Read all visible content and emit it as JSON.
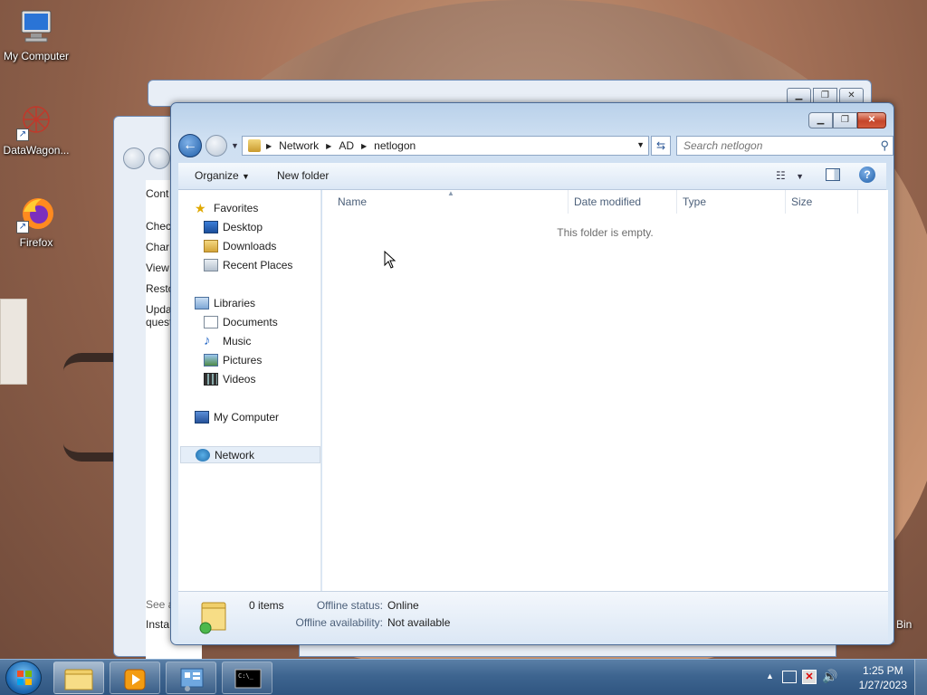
{
  "desktop": {
    "icons": [
      {
        "label": "My Computer"
      },
      {
        "label": "DataWagon..."
      },
      {
        "label": "Firefox"
      }
    ],
    "recycle_bin_partial": "Bin"
  },
  "back_window": {
    "links": [
      "Cont",
      "Chec",
      "Char",
      "View",
      "Resto",
      "Upda",
      "quest"
    ],
    "footer": [
      "See a",
      "Insta"
    ]
  },
  "explorer": {
    "caption_buttons": {
      "minimize": "▁",
      "maximize": "❐",
      "close": "✕"
    },
    "address": {
      "crumbs": [
        "Network",
        "AD",
        "netlogon"
      ]
    },
    "search": {
      "placeholder": "Search netlogon"
    },
    "toolbar": {
      "organize": "Organize",
      "new_folder": "New folder"
    },
    "nav": {
      "favorites": "Favorites",
      "desktop": "Desktop",
      "downloads": "Downloads",
      "recent_places": "Recent Places",
      "libraries": "Libraries",
      "documents": "Documents",
      "music": "Music",
      "pictures": "Pictures",
      "videos": "Videos",
      "my_computer": "My Computer",
      "network": "Network"
    },
    "columns": {
      "name": "Name",
      "date_modified": "Date modified",
      "type": "Type",
      "size": "Size"
    },
    "empty_message": "This folder is empty.",
    "details": {
      "items": "0 items",
      "offline_status_label": "Offline status:",
      "offline_status_value": "Online",
      "offline_availability_label": "Offline availability:",
      "offline_availability_value": "Not available"
    }
  },
  "taskbar": {
    "clock": {
      "time": "1:25 PM",
      "date": "1/27/2023"
    }
  },
  "colors": {
    "accent": "#1f5ea8",
    "taskbar": "#3e6590",
    "close": "#c5452a"
  }
}
